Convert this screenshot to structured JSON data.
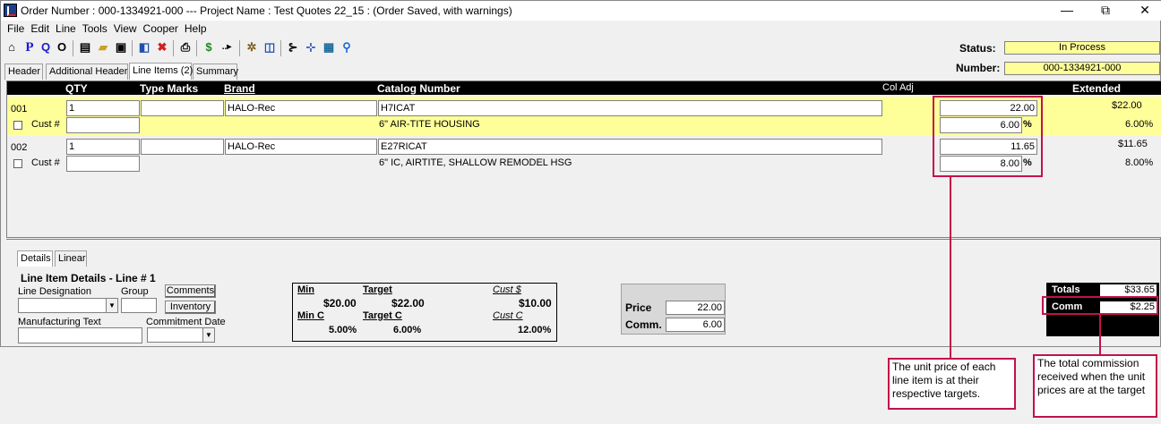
{
  "window": {
    "title": "Order Number : 000-1334921-000 --- Project Name : Test Quotes 22_15 : (Order Saved, with warnings)",
    "minimize": "—",
    "restore": "⧉",
    "close": "✕"
  },
  "menu": [
    "File",
    "Edit",
    "Line",
    "Tools",
    "View",
    "Cooper",
    "Help"
  ],
  "status": {
    "status_label": "Status:",
    "status_value": "In Process",
    "number_label": "Number:",
    "number_value": "000-1334921-000"
  },
  "tabs": [
    "Header",
    "Additional Header",
    "Line Items (2)",
    "Summary"
  ],
  "grid": {
    "headers": {
      "qty": "QTY",
      "type_marks": "Type Marks",
      "brand": "Brand",
      "catalog": "Catalog Number",
      "col_adj": "Col Adj",
      "extended": "Extended"
    },
    "cust_label": "Cust #",
    "rows": [
      {
        "line": "001",
        "qty": "1",
        "type_marks": "",
        "brand": "HALO-Rec",
        "catalog": "H7ICAT",
        "description": "6\" AIR-TITE HOUSING",
        "price": "22.00",
        "comm": "6.00",
        "pct": "%",
        "extended": "$22.00",
        "ext_comm": "6.00%"
      },
      {
        "line": "002",
        "qty": "1",
        "type_marks": "",
        "brand": "HALO-Rec",
        "catalog": "E27RICAT",
        "description": "6\" IC, AIRTITE, SHALLOW REMODEL HSG",
        "price": "11.65",
        "comm": "8.00",
        "pct": "%",
        "extended": "$11.65",
        "ext_comm": "8.00%"
      }
    ]
  },
  "details": {
    "tabs": [
      "Details",
      "Linear"
    ],
    "heading": "Line Item Details - Line # 1",
    "line_designation": "Line Designation",
    "group": "Group",
    "comments_btn": "Comments",
    "inventory_btn": "Inventory",
    "manufacturing_text": "Manufacturing Text",
    "commitment_date": "Commitment Date",
    "pricing": {
      "min_label": "Min",
      "min_value": "$20.00",
      "target_label": "Target",
      "target_value": "$22.00",
      "cust_label": "Cust $",
      "cust_value": "$10.00",
      "minc_label": "Min C",
      "minc_value": "5.00%",
      "targetc_label": "Target C",
      "targetc_value": "6.00%",
      "custc_label": "Cust C",
      "custc_value": "12.00%"
    },
    "price_label": "Price",
    "price_value": "22.00",
    "comm_label": "Comm.",
    "comm_value": "6.00"
  },
  "totals": {
    "totals_label": "Totals",
    "totals_value": "$33.65",
    "comm_label": "Comm",
    "comm_value": "$2.25"
  },
  "annotations": {
    "unit_price": "The unit price of each line item is at their respective targets.",
    "total_comm": "The total commission received when the unit prices are at the target"
  },
  "colors": {
    "highlight": "#ffff99",
    "annotation": "#c2124a"
  }
}
